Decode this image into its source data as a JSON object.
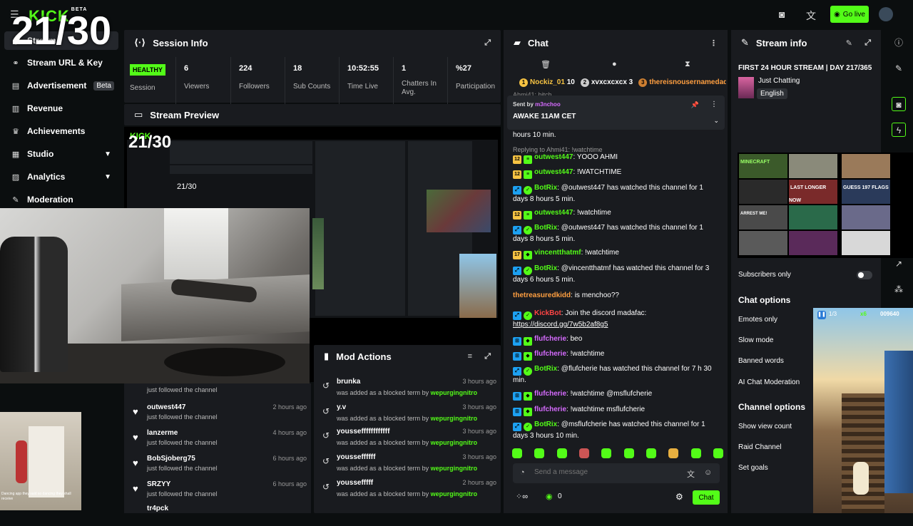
{
  "overlay": {
    "counter": "21/30"
  },
  "topbar": {
    "brand": "KICK",
    "brand_tag": "BETA",
    "go_live": "Go live"
  },
  "sidebar": {
    "items": [
      {
        "label": "Stream",
        "icon": "broadcast-icon"
      },
      {
        "label": "Stream URL & Key",
        "icon": "link-icon"
      },
      {
        "label": "Advertisement",
        "icon": "ad-icon",
        "badge": "Beta"
      },
      {
        "label": "Revenue",
        "icon": "chart-icon"
      },
      {
        "label": "Achievements",
        "icon": "trophy-icon"
      },
      {
        "label": "Studio",
        "icon": "grid-icon"
      },
      {
        "label": "Analytics",
        "icon": "analytics-icon"
      },
      {
        "label": "Moderation",
        "icon": "wrench-icon"
      }
    ]
  },
  "session": {
    "title": "Session Info",
    "healthy": "HEALTHY",
    "session_label": "Session",
    "stats": [
      {
        "value": "6",
        "label": "Viewers"
      },
      {
        "value": "224",
        "label": "Followers"
      },
      {
        "value": "18",
        "label": "Sub Counts"
      },
      {
        "value": "10:52:55",
        "label": "Time Live"
      },
      {
        "value": "1",
        "label": "Chatters In Avg."
      },
      {
        "value": "%27",
        "label": "Participation"
      }
    ]
  },
  "preview": {
    "title": "Stream Preview"
  },
  "followers": {
    "first_sub": "just followed the channel",
    "rows": [
      {
        "name": "outwest447",
        "sub": "just followed the channel",
        "time": "2 hours ago"
      },
      {
        "name": "lanzerme",
        "sub": "just followed the channel",
        "time": "4 hours ago"
      },
      {
        "name": "BobSjoberg75",
        "sub": "just followed the channel",
        "time": "6 hours ago"
      },
      {
        "name": "SRZYY",
        "sub": "just followed the channel",
        "time": "6 hours ago"
      },
      {
        "name": "tr4pck",
        "sub": "",
        "time": ""
      }
    ]
  },
  "modactions": {
    "title": "Mod Actions",
    "rows": [
      {
        "name": "brunka",
        "desc": "was added as a blocked term by",
        "by": "wepurgingnitro",
        "time": "3 hours ago"
      },
      {
        "name": "y.v",
        "desc": "was added as a blocked term by",
        "by": "wepurgingnitro",
        "time": "3 hours ago"
      },
      {
        "name": "yousseffffffffffff",
        "desc": "was added as a blocked term by",
        "by": "wepurgingnitro",
        "time": "3 hours ago"
      },
      {
        "name": "yousseffffff",
        "desc": "was added as a blocked term by",
        "by": "wepurgingnitro",
        "time": "3 hours ago"
      },
      {
        "name": "youssefffff",
        "desc": "was added as a blocked term by",
        "by": "wepurgingnitro",
        "time": "2 hours ago"
      }
    ]
  },
  "tinycam": {
    "caption": "Dancing app they said so dancing they shall receive"
  },
  "chat": {
    "title": "Chat",
    "top_chatters": [
      {
        "rank": "1",
        "name": "Nockiz_01",
        "score": "10"
      },
      {
        "rank": "2",
        "name": "xvxcxcxcx",
        "score": "3"
      },
      {
        "rank": "3",
        "name": "thereisnousernamedada",
        "score": ""
      }
    ],
    "pinned": {
      "sent_by": "Sent by",
      "user": "m3nchoo",
      "text": "AWAKE 11AM CET"
    },
    "overflow_line": "Ahmi41: bitch",
    "partial_line": "hours 10 min.",
    "reply_line": "Replying to Ahmi41: !watchtime",
    "messages": [
      {
        "user": "outwest447",
        "text": ": YOOO AHMI",
        "sub": "12"
      },
      {
        "user": "outwest447",
        "text": ": !WATCHTIME",
        "sub": "12"
      },
      {
        "user": "BotRix",
        "text": ": @outwest447 has watched this channel for 1 days 8 hours 5 min."
      },
      {
        "user": "outwest447",
        "text": ": !watchtime",
        "sub": "12"
      },
      {
        "user": "BotRix",
        "text": ": @outwest447 has watched this channel for 1 days 8 hours 5 min."
      },
      {
        "user": "vincentthatmf",
        "text": ": !watchtime",
        "sub": "17"
      },
      {
        "user": "BotRix",
        "text": ": @vincentthatmf has watched this channel for 3 days 6 hours 5 min."
      },
      {
        "user": "thetreasuredkidd",
        "text": ":   is menchoo??"
      },
      {
        "user": "KickBot",
        "text": ": Join the discord madafac: ",
        "link": "https://discord.gg/7w5b2af8g5"
      },
      {
        "user": "flufcherie",
        "text": ": beo"
      },
      {
        "user": "flufcherie",
        "text": ": !watchtime"
      },
      {
        "user": "BotRix",
        "text": ": @flufcherie has watched this channel for 7 h 30 min."
      },
      {
        "user": "flufcherie",
        "text": ": !watchtime @msflufcherie"
      },
      {
        "user": "flufcherie",
        "text": ": !watchtime msflufcherie"
      },
      {
        "user": "BotRix",
        "text": ": @msflufcherie has watched this channel for 1 days 3 hours 10 min."
      }
    ],
    "input_placeholder": "Send a message",
    "points": "0",
    "send_label": "Chat"
  },
  "streaminfo": {
    "title": "Stream info",
    "stream_title": "FIRST 24 HOUR STREAM | DAY 217/365",
    "category": "Just Chatting",
    "language": "English",
    "subscribers_only": "Subscribers only",
    "chat_options_head": "Chat options",
    "chat_options": [
      "Emotes only",
      "Slow mode",
      "Banned words",
      "AI Chat Moderation"
    ],
    "channel_options_head": "Channel options",
    "channel_options": [
      "Show view count",
      "Raid Channel",
      "Set goals"
    ]
  },
  "thumbs": {
    "labels": [
      "MINECRAFT",
      "LAST LONGER NOW",
      "GUESS 197 FLAGS",
      "ARREST ME!"
    ],
    "colors": [
      "#3b5a2a",
      "#7a2a2a",
      "#2a3a5a",
      "#5a4a2a",
      "#2a5a5a",
      "#8a8a7a",
      "#2a6a4a",
      "#5a2a5a",
      "#4a4a4a",
      "#6a6a8a",
      "#2a2a2a",
      "#9a7a5a"
    ]
  },
  "subway": {
    "score": "009640",
    "multiplier": "x6",
    "lives": "1/3"
  },
  "colors": {
    "accent": "#53fc18",
    "panel": "#191b1f",
    "bg": "#0b0e0f"
  }
}
